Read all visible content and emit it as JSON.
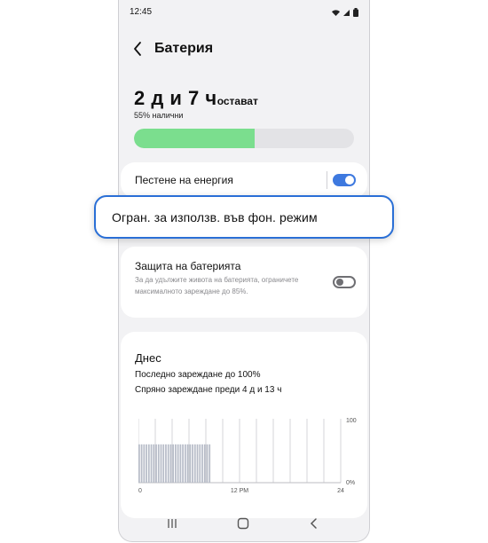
{
  "status_bar": {
    "time": "12:45",
    "icons": [
      "wifi-icon",
      "signal-icon",
      "battery-icon"
    ]
  },
  "header": {
    "title": "Батерия",
    "back_icon": "chevron-left-icon"
  },
  "battery": {
    "remaining_big": "2 д и 7 ч",
    "remaining_suffix": "остават",
    "available": "55% налични",
    "level": 0.55,
    "bar_color": "#7bde8e"
  },
  "power_saving": {
    "label": "Пестене на енергия",
    "enabled": true,
    "accent": "#3e79df"
  },
  "callout": {
    "label": "Огран. за използв. във фон. режим"
  },
  "battery_protection": {
    "label": "Защита на батерията",
    "description": "За да удължите живота на батерията, ограничете максималното зареждане до 85%.",
    "enabled": false
  },
  "today": {
    "title": "Днес",
    "last_charge": "Последно зареждане до 100%",
    "stopped_charge": "Спряно зареждане преди 4 д и 13 ч"
  },
  "chart_data": {
    "type": "bar",
    "x_ticks": [
      "0",
      "12 PM",
      "24"
    ],
    "y_ticks": [
      "100",
      "0%"
    ],
    "ylim": [
      0,
      100
    ],
    "grid": true,
    "values": [
      60,
      60,
      60,
      60,
      60,
      60,
      60,
      60,
      60,
      60,
      60,
      60,
      60,
      60,
      60,
      60,
      60,
      60,
      60,
      60,
      60,
      60,
      60,
      60,
      60,
      60,
      60,
      60,
      60,
      60
    ]
  },
  "navbar": {
    "icons": [
      "recents-icon",
      "home-icon",
      "back-icon"
    ]
  }
}
